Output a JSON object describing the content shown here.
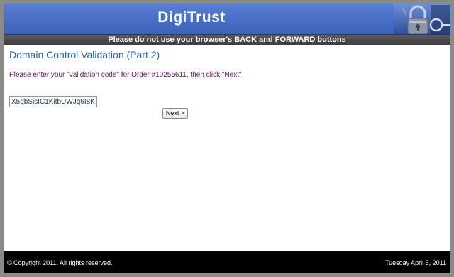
{
  "header": {
    "brand": "DigiTrust",
    "logo_icon": "padlock-keys-icon"
  },
  "warning_bar": {
    "text": "Please do not use your browser's BACK and FORWARD buttons"
  },
  "main": {
    "title": "Domain Control Validation (Part 2)",
    "instructions": "Please enter your \"validation code\" for Order #10255611, then click \"Next\"",
    "validation_input": {
      "value": "X5qbSisIC1KitbUWJq6I8K"
    },
    "next_button_label": "Next >"
  },
  "footer": {
    "copyright": "© Copyright 2011. All rights reserved.",
    "date": "Tuesday April 5, 2011"
  },
  "colors": {
    "header_blue": "#4a70c8",
    "title_blue": "#2b62a8",
    "instruction_purple": "#5c1a5c",
    "footer_black": "#000000"
  }
}
